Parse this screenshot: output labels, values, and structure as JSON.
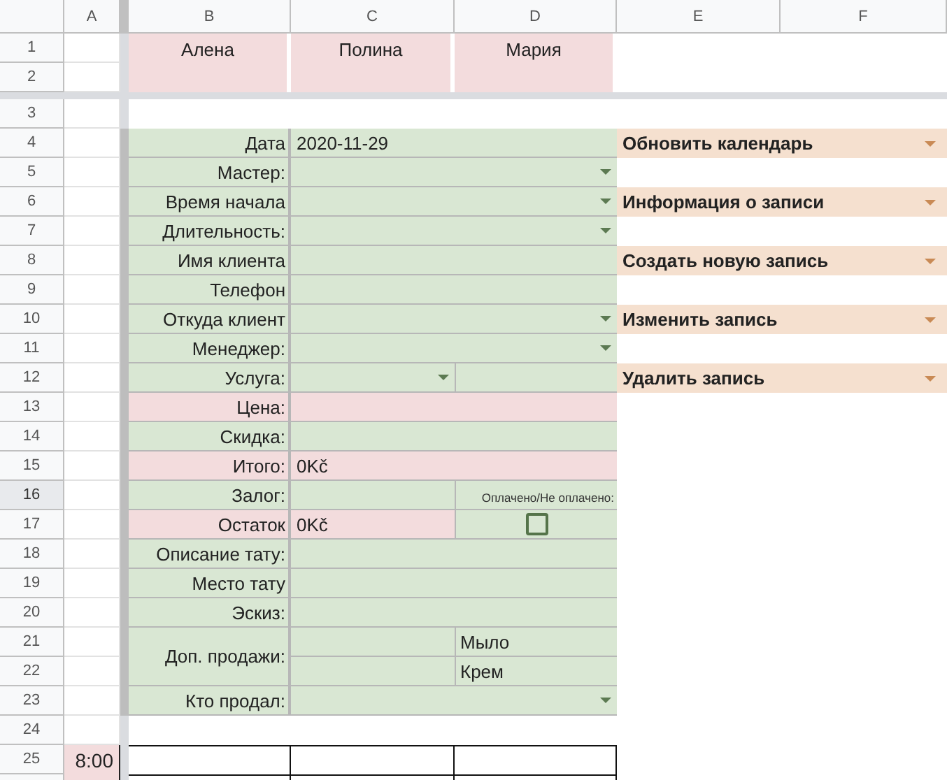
{
  "columns": [
    "A",
    "B",
    "C",
    "D",
    "E",
    "F"
  ],
  "row_numbers": [
    {
      "label": "1",
      "selected": false
    },
    {
      "label": "2",
      "selected": false
    },
    {
      "label": "3",
      "selected": false
    },
    {
      "label": "4",
      "selected": false
    },
    {
      "label": "5",
      "selected": false
    },
    {
      "label": "6",
      "selected": false
    },
    {
      "label": "7",
      "selected": false
    },
    {
      "label": "8",
      "selected": false
    },
    {
      "label": "9",
      "selected": false
    },
    {
      "label": "10",
      "selected": false
    },
    {
      "label": "11",
      "selected": false
    },
    {
      "label": "12",
      "selected": false
    },
    {
      "label": "13",
      "selected": false
    },
    {
      "label": "14",
      "selected": false
    },
    {
      "label": "15",
      "selected": false
    },
    {
      "label": "16",
      "selected": true
    },
    {
      "label": "17",
      "selected": false
    },
    {
      "label": "18",
      "selected": false
    },
    {
      "label": "19",
      "selected": false
    },
    {
      "label": "20",
      "selected": false
    },
    {
      "label": "21",
      "selected": false
    },
    {
      "label": "22",
      "selected": false
    },
    {
      "label": "23",
      "selected": false
    },
    {
      "label": "24",
      "selected": false
    },
    {
      "label": "25",
      "selected": false
    }
  ],
  "masters": [
    "Алена",
    "Полина",
    "Мария"
  ],
  "form": [
    {
      "label": "Дата",
      "color": "#d9e7d3",
      "kind": "wide",
      "value": "2020-11-29",
      "dropdown": false
    },
    {
      "label": "Мастер:",
      "color": "#d9e7d3",
      "kind": "wide",
      "dropdown": true
    },
    {
      "label": "Время начала",
      "color": "#d9e7d3",
      "kind": "wide",
      "dropdown": true
    },
    {
      "label": "Длительность:",
      "color": "#d9e7d3",
      "kind": "wide",
      "dropdown": true
    },
    {
      "label": "Имя клиента",
      "color": "#d9e7d3",
      "kind": "wide",
      "dropdown": false
    },
    {
      "label": "Телефон",
      "color": "#d9e7d3",
      "kind": "wide",
      "dropdown": false
    },
    {
      "label": "Откуда клиент",
      "color": "#d9e7d3",
      "kind": "wide",
      "dropdown": true
    },
    {
      "label": "Менеджер:",
      "color": "#d9e7d3",
      "kind": "wide",
      "dropdown": true
    },
    {
      "label": "Услуга:",
      "color": "#d9e7d3",
      "kind": "split",
      "dropdown": true
    },
    {
      "label": "Цена:",
      "color": "#f3dcdd",
      "kind": "wide",
      "dropdown": false
    },
    {
      "label": "Скидка:",
      "color": "#d9e7d3",
      "kind": "wide",
      "dropdown": false
    },
    {
      "label": "Итого:",
      "color": "#f3dcdd",
      "kind": "wide",
      "value": "0Kč",
      "dropdown": false
    },
    {
      "label": "Залог:",
      "color": "#d9e7d3",
      "kind": "split",
      "dropdown": false,
      "extra": {
        "kind": "note",
        "text": "Оплачено/Не оплачено:"
      }
    },
    {
      "label": "Остаток",
      "color": "#f3dcdd",
      "kind": "split",
      "value": "0Kč",
      "dropdown": false,
      "extra": {
        "kind": "checkbox",
        "checked": false
      }
    },
    {
      "label": "Описание тату:",
      "color": "#d9e7d3",
      "kind": "wide",
      "dropdown": false
    },
    {
      "label": "Место тату",
      "color": "#d9e7d3",
      "kind": "wide",
      "dropdown": false
    },
    {
      "label": "Эскиз:",
      "color": "#d9e7d3",
      "kind": "wide",
      "dropdown": false
    },
    {
      "label": "Доп. продажи:",
      "color": "#d9e7d3",
      "kind": "multi",
      "dropdown": false,
      "lines": [
        "Мыло",
        "Крем"
      ]
    },
    {
      "label": "Кто продал:",
      "color": "#d9e7d3",
      "kind": "wide",
      "dropdown": true
    }
  ],
  "actions": [
    "Обновить календарь",
    "Информация о записи",
    "Создать новую запись",
    "Изменить запись",
    "Удалить запись"
  ],
  "schedule": [
    {
      "time": "8:00"
    }
  ]
}
